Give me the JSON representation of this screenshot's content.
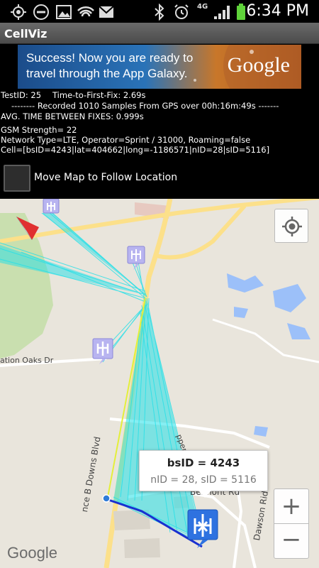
{
  "status_bar": {
    "network": "4G",
    "time": "6:34 PM",
    "icons": [
      "gps-icon",
      "do-not-disturb-icon",
      "gallery-icon",
      "wifi-hotspot-icon",
      "mail-icon",
      "bluetooth-icon",
      "alarm-icon",
      "signal-icon",
      "battery-icon"
    ]
  },
  "app": {
    "title": "CellViz"
  },
  "ad": {
    "text": "Success! Now you are ready to travel through the App Galaxy.",
    "logo": "Google"
  },
  "info": {
    "test_id": "TestID: 25",
    "ttff": "Time-to-First-Fix: 2.69s",
    "recorded": "-------- Recorded 1010 Samples From GPS over 00h:16m:49s -------",
    "avg_time": "AVG. TIME BETWEEN FIXES: 0.999s",
    "gsm": "GSM Strength= 22",
    "network": "Network Type=LTE, Operator=Sprint / 31000, Roaming=false",
    "cell": "Cell=[bsID=4243|lat=404662|long=-1186571|nID=28|sID=5116]"
  },
  "follow": {
    "label": "Move Map to Follow Location",
    "checked": false
  },
  "map": {
    "streets": [
      "ation Oaks Dr",
      "nce B Downs Blvd",
      "Dawson Rid",
      "Belmont Rd",
      "ppertree Dr"
    ],
    "info_window": {
      "title": "bsID = 4243",
      "snippet": "nID = 28, sID = 5116"
    },
    "google_logo": "Google",
    "zoom_in": "+",
    "zoom_out": "−",
    "colors": {
      "lines": "#22e0e8",
      "route": "#1a2fd0",
      "road": "#fce08a",
      "water": "#9cc0f9",
      "park": "#c9dfaf"
    }
  }
}
